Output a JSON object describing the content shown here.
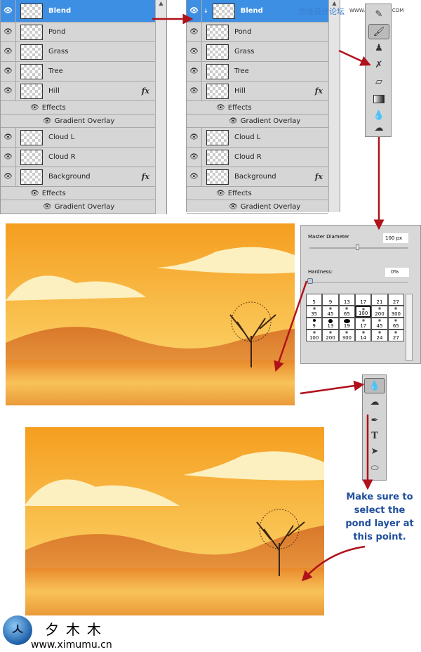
{
  "watermark_top": {
    "cn": "思缘设计论坛",
    "url": "WWW.MISSYUAN.COM"
  },
  "layers_before": [
    {
      "name": "Blend",
      "selected": true
    },
    {
      "name": "Pond"
    },
    {
      "name": "Grass"
    },
    {
      "name": "Tree"
    },
    {
      "name": "Hill",
      "fx": "fx",
      "effects": "Effects",
      "effect_items": [
        "Gradient Overlay"
      ]
    },
    {
      "name": "Cloud L"
    },
    {
      "name": "Cloud R"
    },
    {
      "name": "Background",
      "fx": "fx",
      "effects": "Effects",
      "effect_items": [
        "Gradient Overlay"
      ]
    }
  ],
  "layers_after": [
    {
      "name": "Blend",
      "selected": true
    },
    {
      "name": "Pond"
    },
    {
      "name": "Grass"
    },
    {
      "name": "Tree"
    },
    {
      "name": "Hill",
      "fx": "fx",
      "effects": "Effects",
      "effect_items": [
        "Gradient Overlay"
      ]
    },
    {
      "name": "Cloud L"
    },
    {
      "name": "Cloud R"
    },
    {
      "name": "Background",
      "fx": "fx",
      "effects": "Effects",
      "effect_items": [
        "Gradient Overlay"
      ]
    }
  ],
  "brush_panel": {
    "master_diameter_label": "Master Diameter",
    "master_diameter_value": "100 px",
    "master_diameter_slider": 0.5,
    "hardness_label": "Hardness:",
    "hardness_value": "0%",
    "hardness_slider": 0,
    "presets": [
      "5",
      "9",
      "13",
      "17",
      "21",
      "27",
      "35",
      "45",
      "65",
      "100",
      "200",
      "300",
      "9",
      "13",
      "19",
      "17",
      "45",
      "65",
      "100",
      "200",
      "300",
      "14",
      "24",
      "27"
    ],
    "selected_preset": "100"
  },
  "toolbox_bottom": {
    "text_tool": "T"
  },
  "callout": "Make sure to select the pond layer at this point.",
  "logo": {
    "cn": "夕木木",
    "url": "www.ximumu.cn"
  },
  "colors": {
    "selection": "#3d8fe4",
    "arrow": "#b0121b",
    "callout": "#1f4e9c"
  }
}
